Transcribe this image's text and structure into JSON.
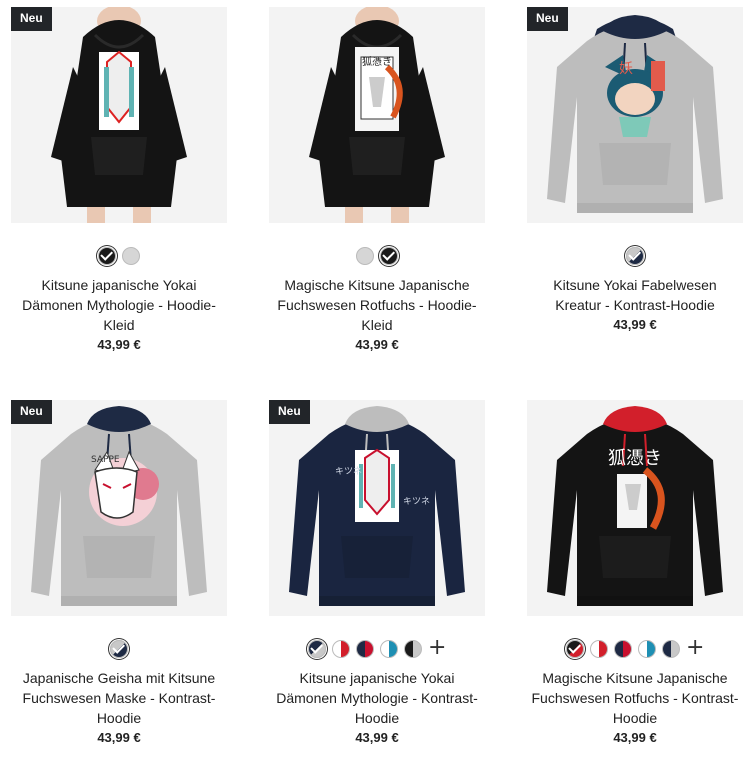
{
  "products": [
    {
      "badge": "Neu",
      "title": "Kitsune japanische Yokai Dämonen Mythologie - Hoodie-Kleid",
      "price": "43,99 €",
      "image_icon": "hoodie-dress-black-kitsune-image",
      "swatches": [
        {
          "name": "black",
          "color": "#1a1a1a",
          "selected": true
        },
        {
          "name": "light-grey",
          "color": "#d6d6d6",
          "selected": false
        }
      ]
    },
    {
      "badge": "",
      "title": "Magische Kitsune Japanische Fuchswesen Rotfuchs - Hoodie-Kleid",
      "price": "43,99 €",
      "image_icon": "hoodie-dress-black-fox-image",
      "swatches": [
        {
          "name": "light-grey",
          "color": "#d6d6d6",
          "selected": false
        },
        {
          "name": "black",
          "color": "#1a1a1a",
          "selected": true
        }
      ]
    },
    {
      "badge": "Neu",
      "title": "Kitsune Yokai Fabelwesen Kreatur - Kontrast-Hoodie",
      "price": "43,99 €",
      "image_icon": "contrast-hoodie-grey-navy-image",
      "swatches": [
        {
          "name": "grey-navy",
          "color": "#c8c8c8",
          "color2": "#1e2a44",
          "selected": true
        }
      ]
    },
    {
      "badge": "Neu",
      "title": "Japanische Geisha mit Kitsune Fuchswesen Maske - Kontrast-Hoodie",
      "price": "43,99 €",
      "image_icon": "contrast-hoodie-grey-navy-geisha-image",
      "swatches": [
        {
          "name": "grey-navy",
          "color": "#c8c8c8",
          "color2": "#1e2a44",
          "selected": true
        }
      ]
    },
    {
      "badge": "Neu",
      "title": "Kitsune japanische Yokai Dämonen Mythologie - Kontrast-Hoodie",
      "price": "43,99 €",
      "image_icon": "contrast-hoodie-navy-grey-image",
      "swatches": [
        {
          "name": "navy-grey",
          "color": "#1e2a44",
          "color2": "#c8c8c8",
          "selected": true
        },
        {
          "name": "white-red",
          "color": "#ffffff",
          "color2": "#d21f2b",
          "selected": false
        },
        {
          "name": "navy-red",
          "color": "#1e2a44",
          "color2": "#c8102e",
          "selected": false
        },
        {
          "name": "white-blue",
          "color": "#ffffff",
          "color2": "#1e8fb3",
          "selected": false
        },
        {
          "name": "black-grey",
          "color": "#1a1a1a",
          "color2": "#c8c8c8",
          "selected": false
        }
      ],
      "more": "+"
    },
    {
      "badge": "",
      "title": "Magische Kitsune Japanische Fuchswesen Rotfuchs - Kontrast-Hoodie",
      "price": "43,99 €",
      "image_icon": "contrast-hoodie-black-red-image",
      "swatches": [
        {
          "name": "black-red",
          "color": "#1a1a1a",
          "color2": "#d21f2b",
          "selected": true
        },
        {
          "name": "white-red",
          "color": "#ffffff",
          "color2": "#d21f2b",
          "selected": false
        },
        {
          "name": "navy-red",
          "color": "#1e2a44",
          "color2": "#c8102e",
          "selected": false
        },
        {
          "name": "white-blue",
          "color": "#ffffff",
          "color2": "#1e8fb3",
          "selected": false
        },
        {
          "name": "navy-grey",
          "color": "#1e2a44",
          "color2": "#c8c8c8",
          "selected": false
        }
      ],
      "more": "+"
    }
  ]
}
